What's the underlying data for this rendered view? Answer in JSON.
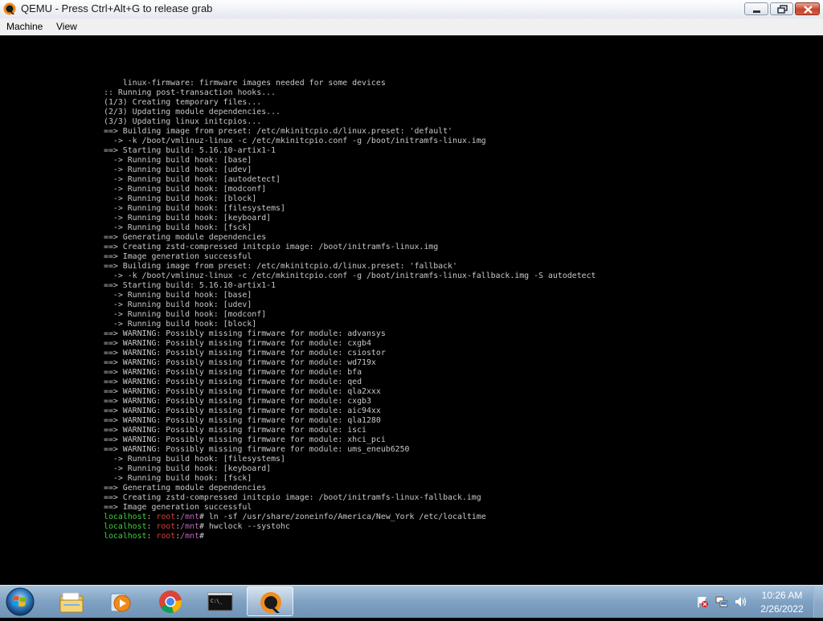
{
  "window": {
    "title": "QEMU - Press Ctrl+Alt+G to release grab",
    "app_icon": "qemu-icon"
  },
  "menubar": {
    "items": [
      "Machine",
      "View"
    ]
  },
  "console": {
    "lines": [
      "    linux-firmware: firmware images needed for some devices",
      ":: Running post-transaction hooks...",
      "(1/3) Creating temporary files...",
      "(2/3) Updating module dependencies...",
      "(3/3) Updating linux initcpios...",
      "==> Building image from preset: /etc/mkinitcpio.d/linux.preset: 'default'",
      "  -> -k /boot/vmlinuz-linux -c /etc/mkinitcpio.conf -g /boot/initramfs-linux.img",
      "==> Starting build: 5.16.10-artix1-1",
      "  -> Running build hook: [base]",
      "  -> Running build hook: [udev]",
      "  -> Running build hook: [autodetect]",
      "  -> Running build hook: [modconf]",
      "  -> Running build hook: [block]",
      "  -> Running build hook: [filesystems]",
      "  -> Running build hook: [keyboard]",
      "  -> Running build hook: [fsck]",
      "==> Generating module dependencies",
      "==> Creating zstd-compressed initcpio image: /boot/initramfs-linux.img",
      "==> Image generation successful",
      "==> Building image from preset: /etc/mkinitcpio.d/linux.preset: 'fallback'",
      "  -> -k /boot/vmlinuz-linux -c /etc/mkinitcpio.conf -g /boot/initramfs-linux-fallback.img -S autodetect",
      "==> Starting build: 5.16.10-artix1-1",
      "  -> Running build hook: [base]",
      "  -> Running build hook: [udev]",
      "  -> Running build hook: [modconf]",
      "  -> Running build hook: [block]",
      "==> WARNING: Possibly missing firmware for module: advansys",
      "==> WARNING: Possibly missing firmware for module: cxgb4",
      "==> WARNING: Possibly missing firmware for module: csiostor",
      "==> WARNING: Possibly missing firmware for module: wd719x",
      "==> WARNING: Possibly missing firmware for module: bfa",
      "==> WARNING: Possibly missing firmware for module: qed",
      "==> WARNING: Possibly missing firmware for module: qla2xxx",
      "==> WARNING: Possibly missing firmware for module: cxgb3",
      "==> WARNING: Possibly missing firmware for module: aic94xx",
      "==> WARNING: Possibly missing firmware for module: qla1280",
      "==> WARNING: Possibly missing firmware for module: isci",
      "==> WARNING: Possibly missing firmware for module: xhci_pci",
      "==> WARNING: Possibly missing firmware for module: ums_eneub6250",
      "  -> Running build hook: [filesystems]",
      "  -> Running build hook: [keyboard]",
      "  -> Running build hook: [fsck]",
      "==> Generating module dependencies",
      "==> Creating zstd-compressed initcpio image: /boot/initramfs-linux-fallback.img",
      "==> Image generation successful"
    ],
    "prompt": {
      "host": "localhost",
      "user": "root",
      "dir": "/mnt",
      "separator": ":",
      "symbol": "#"
    },
    "commands": [
      "ln -sf /usr/share/zoneinfo/America/New_York /etc/localtime",
      "hwclock --systohc",
      ""
    ],
    "colors": {
      "text": "#c8c8c8",
      "host": "#3cd23c",
      "user": "#e03c3c",
      "dir": "#c060c0"
    }
  },
  "taskbar": {
    "start_icon": "windows-start-icon",
    "pinned": [
      {
        "name": "explorer-icon"
      },
      {
        "name": "media-player-icon"
      },
      {
        "name": "chrome-icon"
      },
      {
        "name": "cmd-icon"
      },
      {
        "name": "qemu-icon",
        "active": true
      }
    ],
    "tray": {
      "icons": [
        "action-center-flag-icon",
        "network-icon",
        "volume-icon"
      ],
      "time": "10:26 AM",
      "date": "2/26/2022"
    }
  }
}
